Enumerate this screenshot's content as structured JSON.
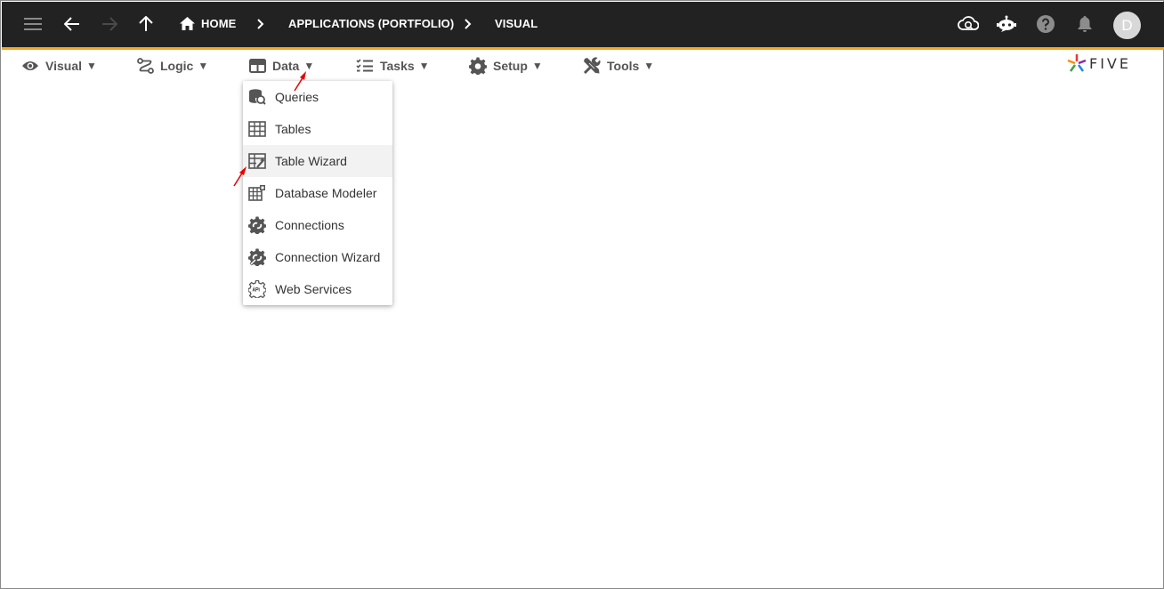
{
  "topbar": {
    "breadcrumbs": [
      "HOME",
      "APPLICATIONS (PORTFOLIO)",
      "VISUAL"
    ],
    "avatar_letter": "D",
    "icons": [
      "menu-icon",
      "back-arrow-icon",
      "forward-arrow-icon",
      "up-arrow-icon",
      "home-icon",
      "cloud-sync-icon",
      "chatbot-icon",
      "help-icon",
      "bell-icon"
    ],
    "accent_color": "#f5a623",
    "bar_color": "#222222"
  },
  "menubar": {
    "items": [
      {
        "label": "Visual",
        "icon": "eye-icon"
      },
      {
        "label": "Logic",
        "icon": "logic-flow-icon"
      },
      {
        "label": "Data",
        "icon": "table-grid-icon"
      },
      {
        "label": "Tasks",
        "icon": "checklist-icon"
      },
      {
        "label": "Setup",
        "icon": "gear-icon"
      },
      {
        "label": "Tools",
        "icon": "tools-icon"
      }
    ],
    "caret": "▼",
    "logo_text": "FIVE"
  },
  "dropdown": {
    "items": [
      {
        "label": "Queries",
        "icon": "database-search-icon"
      },
      {
        "label": "Tables",
        "icon": "table-icon"
      },
      {
        "label": "Table Wizard",
        "icon": "table-wizard-icon"
      },
      {
        "label": "Database Modeler",
        "icon": "database-modeler-icon"
      },
      {
        "label": "Connections",
        "icon": "connections-icon"
      },
      {
        "label": "Connection Wizard",
        "icon": "connection-wizard-icon"
      },
      {
        "label": "Web Services",
        "icon": "api-gear-icon"
      }
    ],
    "highlighted": "Table Wizard"
  }
}
